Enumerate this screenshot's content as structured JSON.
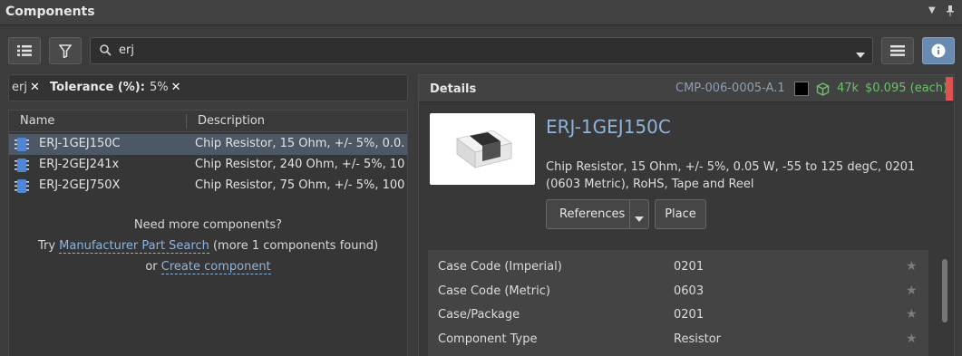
{
  "panel": {
    "title": "Components"
  },
  "toolbar": {
    "view_icon": "list-icon",
    "filter_icon": "filter-icon",
    "menu_icon": "hamburger-menu-icon",
    "info_icon": "info-icon"
  },
  "search": {
    "value": "erj"
  },
  "filters": {
    "chips": [
      {
        "label": "erj"
      },
      {
        "label": "Tolerance (%):",
        "value": "5%"
      }
    ]
  },
  "list": {
    "columns": [
      "Name",
      "Description"
    ],
    "rows": [
      {
        "name": "ERJ-1GEJ150C",
        "description": "Chip Resistor, 15 Ohm, +/- 5%, 0.0...",
        "selected": true
      },
      {
        "name": "ERJ-2GEJ241x",
        "description": "Chip Resistor, 240 Ohm, +/- 5%, 10...",
        "selected": false
      },
      {
        "name": "ERJ-2GEJ750X",
        "description": "Chip Resistor, 75 Ohm, +/- 5%, 100...",
        "selected": false
      }
    ],
    "more": {
      "question": "Need more components?",
      "try_prefix": "Try",
      "mps_link": "Manufacturer Part Search",
      "mps_suffix": "(more 1 components found)",
      "or_prefix": "or",
      "create_link": "Create component"
    }
  },
  "details": {
    "label": "Details",
    "cmp_id": "CMP-006-0005-A.1",
    "stock": "47k",
    "price": "$0.095 (each)",
    "part_name": "ERJ-1GEJ150C",
    "description": "Chip Resistor, 15 Ohm, +/- 5%, 0.05 W, -55 to 125 degC, 0201 (0603 Metric), RoHS, Tape and Reel",
    "buttons": {
      "references": "References",
      "place": "Place"
    },
    "colors": {
      "stock": "#6cc06c",
      "accent": "#8fb4dc",
      "status_bar": "#e05252"
    },
    "parameters": [
      {
        "name": "Case Code (Imperial)",
        "value": "0201"
      },
      {
        "name": "Case Code (Metric)",
        "value": "0603"
      },
      {
        "name": "Case/Package",
        "value": "0201"
      },
      {
        "name": "Component Type",
        "value": "Resistor"
      }
    ]
  }
}
